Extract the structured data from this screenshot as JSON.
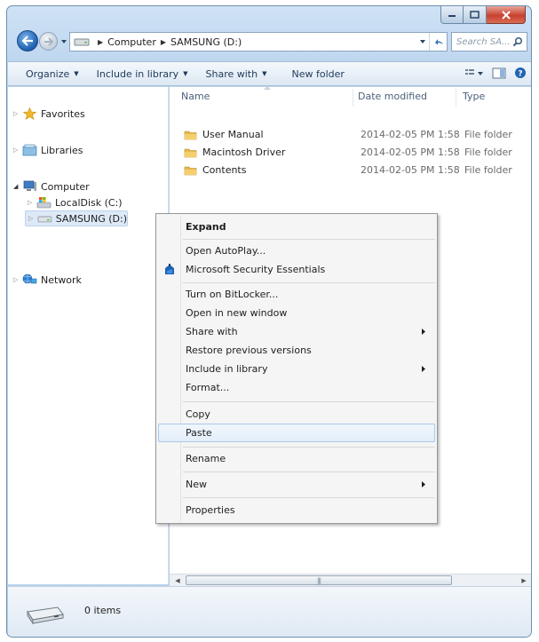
{
  "window": {
    "address": {
      "crumbs": [
        "Computer",
        "SAMSUNG (D:)"
      ]
    },
    "search_placeholder": "Search SA...",
    "toolbar": {
      "organize": "Organize",
      "include_in_library": "Include in library",
      "share_with": "Share with",
      "new_folder": "New folder"
    },
    "nav": {
      "favorites": "Favorites",
      "libraries": "Libraries",
      "computer": "Computer",
      "local_disk": "LocalDisk (C:)",
      "samsung": "SAMSUNG (D:)",
      "network": "Network"
    },
    "columns": {
      "name": "Name",
      "date_modified": "Date modified",
      "type": "Type"
    },
    "files": [
      {
        "name": "User Manual",
        "date": "2014-02-05 PM 1:58",
        "type": "File folder"
      },
      {
        "name": "Macintosh Driver",
        "date": "2014-02-05 PM 1:58",
        "type": "File folder"
      },
      {
        "name": "Contents",
        "date": "2014-02-05 PM 1:58",
        "type": "File folder"
      }
    ],
    "status": {
      "items": "0 items"
    }
  },
  "context_menu": {
    "expand": "Expand",
    "open_autoplay": "Open AutoPlay...",
    "mse": "Microsoft Security Essentials",
    "bitlocker": "Turn on BitLocker...",
    "open_new_window": "Open in new window",
    "share_with": "Share with",
    "restore": "Restore previous versions",
    "include_library": "Include in library",
    "format": "Format...",
    "copy": "Copy",
    "paste": "Paste",
    "rename": "Rename",
    "new": "New",
    "properties": "Properties"
  },
  "colors": {
    "frame": "#bcd5ee",
    "selection": "#dde9f6",
    "menu_hover": "#a8c8ea",
    "close_button": "#c8412f"
  }
}
